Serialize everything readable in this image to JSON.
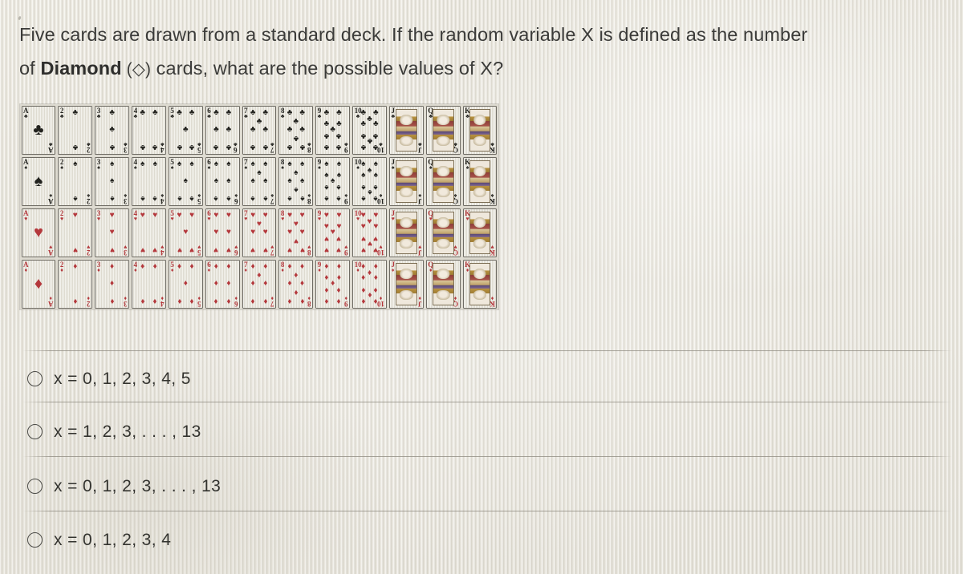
{
  "question": {
    "line1_pre": "Five cards are drawn from a standard deck. If the random variable X is defined as the number",
    "line2_pre": "of ",
    "line2_bold": "Diamond",
    "line2_suit": " (◇)",
    "line2_post": " cards, what are the possible values of X?",
    "full_text": "Five cards are drawn from a standard deck. If the random variable X is defined as the number of Diamond (◇) cards, what are the possible values of X?"
  },
  "deck": {
    "alt": "standard 52-card deck chart, four suit rows by thirteen rank columns",
    "ranks": [
      "A",
      "2",
      "3",
      "4",
      "5",
      "6",
      "7",
      "8",
      "9",
      "10",
      "J",
      "Q",
      "K"
    ],
    "rows": [
      {
        "suit_name": "clubs",
        "symbol": "♣",
        "color": "#23231f"
      },
      {
        "suit_name": "spades",
        "symbol": "♠",
        "color": "#23231f"
      },
      {
        "suit_name": "hearts",
        "symbol": "♥",
        "color": "#b4383c"
      },
      {
        "suit_name": "diamonds",
        "symbol": "♦",
        "color": "#b4383c"
      }
    ]
  },
  "options": [
    {
      "id": "option-a",
      "label": "x = 0, 1, 2, 3, 4, 5",
      "selected": false
    },
    {
      "id": "option-b",
      "label": "x = 1, 2, 3, . . . , 13",
      "selected": false
    },
    {
      "id": "option-c",
      "label": "x = 0, 1, 2, 3, . . . , 13",
      "selected": false
    },
    {
      "id": "option-d",
      "label": "x = 0, 1, 2, 3, 4",
      "selected": false
    }
  ],
  "colors": {
    "paper": "#e8e5db",
    "text": "#33332f",
    "rule": "#8c887e",
    "red_suit": "#b4383c",
    "black_suit": "#23231f"
  }
}
